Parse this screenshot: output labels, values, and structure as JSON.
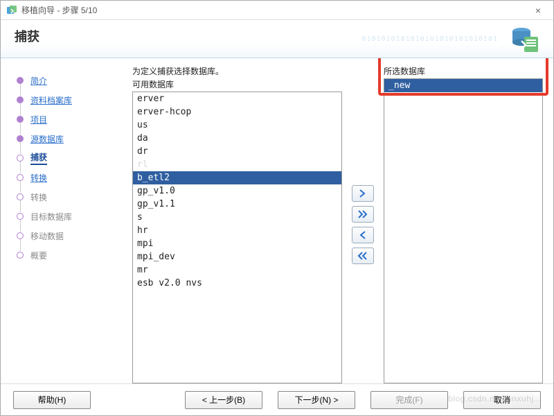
{
  "window": {
    "title": "移植向导 - 步骤 5/10",
    "close": "×"
  },
  "header": {
    "title": "捕获",
    "binary": "0101010101010101010101010101"
  },
  "steps": [
    {
      "label": "简介",
      "state": "done link"
    },
    {
      "label": "资料档案库",
      "state": "done link"
    },
    {
      "label": "项目",
      "state": "done link"
    },
    {
      "label": "源数据库",
      "state": "done link"
    },
    {
      "label": "捕获",
      "state": "current"
    },
    {
      "label": "转换",
      "state": "link"
    },
    {
      "label": "转换",
      "state": "disabled"
    },
    {
      "label": "目标数据库",
      "state": "disabled"
    },
    {
      "label": "移动数据",
      "state": "disabled"
    },
    {
      "label": "概要",
      "state": "disabled"
    }
  ],
  "panel": {
    "instruction": "为定义捕获选择数据库。",
    "available_label": "可用数据库",
    "selected_label": "所选数据库",
    "available": [
      {
        "text": " ",
        "blur": true
      },
      {
        "text": " ",
        "blur": true
      },
      {
        "text": " ",
        "blur": true
      },
      {
        "text": "      erver"
      },
      {
        "text": "      erver-hcop"
      },
      {
        "text": " ",
        "blur": true
      },
      {
        "text": "    us"
      },
      {
        "text": "    da"
      },
      {
        "text": "    dr"
      },
      {
        "text": "   rl  ",
        "blur": true
      },
      {
        "text": "   b_etl2",
        "sel": true
      },
      {
        "text": "   gp_v1.0"
      },
      {
        "text": "   gp_v1.1"
      },
      {
        "text": "  s"
      },
      {
        "text": "   hr"
      },
      {
        "text": "   mpi"
      },
      {
        "text": "   mpi_dev"
      },
      {
        "text": "   mr"
      },
      {
        "text": "  esb v2.0 nvs"
      }
    ],
    "selected": [
      {
        "text": "      _new",
        "sel": true
      }
    ]
  },
  "buttons": {
    "move_right": "»",
    "move_all_right": "»»",
    "move_left": "«",
    "move_all_left": "««"
  },
  "footer": {
    "help": "帮助(H)",
    "back": "< 上一步(B)",
    "next": "下一步(N) >",
    "finish": "完成(F)",
    "cancel": "取消"
  },
  "watermark": "blog.csdn.net/junxuhj..."
}
